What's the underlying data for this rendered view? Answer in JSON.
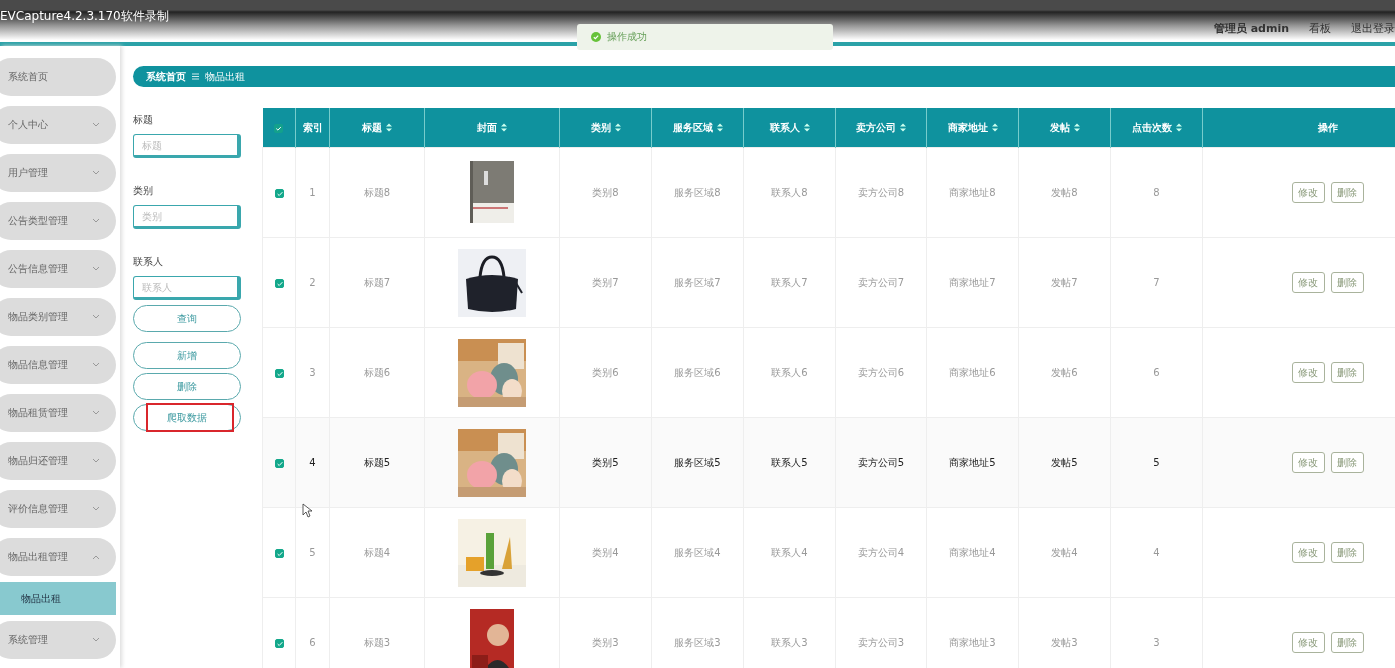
{
  "recorder": {
    "title": "EVCapture4.2.3.170软件录制"
  },
  "header": {
    "user": "管理员 admin",
    "links": [
      "看板",
      "退出登录"
    ]
  },
  "toast": {
    "kind": "success",
    "message": "操作成功"
  },
  "sidebar": {
    "items": [
      {
        "label": "系统首页",
        "kind": "link"
      },
      {
        "label": "个人中心",
        "kind": "menu",
        "expanded": false
      },
      {
        "label": "用户管理",
        "kind": "menu",
        "expanded": false
      },
      {
        "label": "公告类型管理",
        "kind": "menu",
        "expanded": false
      },
      {
        "label": "公告信息管理",
        "kind": "menu",
        "expanded": false
      },
      {
        "label": "物品类别管理",
        "kind": "menu",
        "expanded": false
      },
      {
        "label": "物品信息管理",
        "kind": "menu",
        "expanded": false
      },
      {
        "label": "物品租赁管理",
        "kind": "menu",
        "expanded": false
      },
      {
        "label": "物品归还管理",
        "kind": "menu",
        "expanded": false
      },
      {
        "label": "评价信息管理",
        "kind": "menu",
        "expanded": false
      },
      {
        "label": "物品出租管理",
        "kind": "menu",
        "expanded": true,
        "children": [
          {
            "label": "物品出租",
            "selected": true
          }
        ]
      },
      {
        "label": "系统管理",
        "kind": "menu",
        "expanded": false
      }
    ]
  },
  "breadcrumb": {
    "items": [
      "系统首页",
      "物品出租"
    ]
  },
  "search": {
    "fields": [
      {
        "label": "标题",
        "placeholder": "标题"
      },
      {
        "label": "类别",
        "placeholder": "类别"
      },
      {
        "label": "联系人",
        "placeholder": "联系人"
      }
    ],
    "buttons": [
      {
        "label": "查询",
        "highlighted": false
      },
      {
        "label": "新增",
        "highlighted": false
      },
      {
        "label": "删除",
        "highlighted": false
      },
      {
        "label": "爬取数据",
        "highlighted": true
      }
    ]
  },
  "table": {
    "all_checked": true,
    "columns": [
      {
        "label": "索引",
        "sortable": false
      },
      {
        "label": "标题",
        "sortable": true
      },
      {
        "label": "封面",
        "sortable": true
      },
      {
        "label": "类别",
        "sortable": true
      },
      {
        "label": "服务区域",
        "sortable": true
      },
      {
        "label": "联系人",
        "sortable": true
      },
      {
        "label": "卖方公司",
        "sortable": true
      },
      {
        "label": "商家地址",
        "sortable": true
      },
      {
        "label": "发帖",
        "sortable": true
      },
      {
        "label": "点击次数",
        "sortable": true
      },
      {
        "label": "操作",
        "sortable": false
      }
    ],
    "rows": [
      {
        "checked": true,
        "hovered": false,
        "cells": [
          "1",
          "标题8",
          {
            "kind": "picture"
          },
          "类别8",
          "服务区域8",
          "联系人8",
          "卖方公司8",
          "商家地址8",
          "发帖8",
          "8",
          {
            "kind": "actions",
            "buttons": [
              "修改",
              "删除"
            ]
          }
        ]
      },
      {
        "checked": true,
        "hovered": false,
        "cells": [
          "2",
          "标题7",
          {
            "kind": "picture"
          },
          "类别7",
          "服务区域7",
          "联系人7",
          "卖方公司7",
          "商家地址7",
          "发帖7",
          "7",
          {
            "kind": "actions",
            "buttons": [
              "修改",
              "删除"
            ]
          }
        ]
      },
      {
        "checked": true,
        "hovered": false,
        "cells": [
          "3",
          "标题6",
          {
            "kind": "picture"
          },
          "类别6",
          "服务区域6",
          "联系人6",
          "卖方公司6",
          "商家地址6",
          "发帖6",
          "6",
          {
            "kind": "actions",
            "buttons": [
              "修改",
              "删除"
            ]
          }
        ]
      },
      {
        "checked": true,
        "hovered": true,
        "cells": [
          "4",
          "标题5",
          {
            "kind": "picture"
          },
          "类别5",
          "服务区域5",
          "联系人5",
          "卖方公司5",
          "商家地址5",
          "发帖5",
          "5",
          {
            "kind": "actions",
            "buttons": [
              "修改",
              "删除"
            ]
          }
        ]
      },
      {
        "checked": true,
        "hovered": false,
        "cells": [
          "5",
          "标题4",
          {
            "kind": "picture"
          },
          "类别4",
          "服务区域4",
          "联系人4",
          "卖方公司4",
          "商家地址4",
          "发帖4",
          "4",
          {
            "kind": "actions",
            "buttons": [
              "修改",
              "删除"
            ]
          }
        ]
      },
      {
        "checked": true,
        "hovered": false,
        "cells": [
          "6",
          "标题3",
          {
            "kind": "picture"
          },
          "类别3",
          "服务区域3",
          "联系人3",
          "卖方公司3",
          "商家地址3",
          "发帖3",
          "3",
          {
            "kind": "actions",
            "buttons": [
              "修改",
              "删除"
            ]
          }
        ]
      }
    ]
  }
}
